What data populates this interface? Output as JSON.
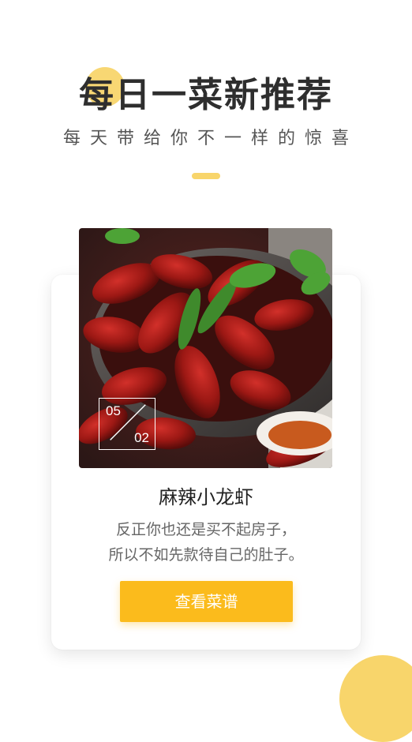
{
  "hero": {
    "title": "每日一菜新推荐",
    "subtitle": "每天带给你不一样的惊喜"
  },
  "recipe_card": {
    "image_icon": "crayfish-dish-image",
    "counter": {
      "current": "05",
      "total": "02"
    },
    "dish_name": "麻辣小龙虾",
    "description_lines": [
      "反正你也还是买不起房子，",
      "所以不如先款待自己的肚子。"
    ],
    "button_label": "查看菜谱"
  },
  "colors": {
    "accent_yellow": "#f8d56b",
    "button_yellow": "#fbbb1c",
    "title_text": "#2e2e2e"
  }
}
